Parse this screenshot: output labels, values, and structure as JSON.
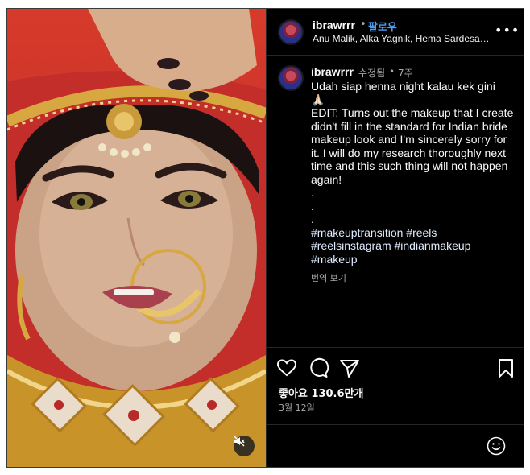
{
  "post": {
    "username": "ibrawrrr",
    "follow_label": "팔로우",
    "header_dot": "•",
    "audio_subtitle": "Anu Malik, Alka Yagnik, Hema Sardesai • Gori Gori",
    "more_glyph": "•••"
  },
  "caption": {
    "username": "ibrawrrr",
    "edited_label": "수정됨",
    "dot": "•",
    "time_ago": "7주",
    "line1": "Udah siap henna night kalau kek gini",
    "emoji": "🙏🏻",
    "edit_text": "EDIT: Turns out the makeup that I create didn't fill in the standard for Indian bride makeup look and I'm sincerely sorry for it. I will do my research thoroughly next time and this such thing will not happen again!",
    "dots": [
      ".",
      ".",
      "."
    ],
    "hashtags": "#makeuptransition #reels #reelsinstagram #indianmakeup #makeup",
    "translate_label": "번역 보기"
  },
  "actions": {
    "likes": "좋아요 130.6만개",
    "date": "3월 12일",
    "icons": [
      "heart-icon",
      "comment-icon",
      "share-icon",
      "bookmark-icon"
    ]
  },
  "media": {
    "mute_icon": "speaker-muted-icon"
  },
  "comment": {
    "emoji_icon": "smiley-icon"
  },
  "colors": {
    "background": "#000000",
    "follow": "#4a9df0",
    "secondary_text": "#a8a8a8",
    "divider": "#262626"
  }
}
